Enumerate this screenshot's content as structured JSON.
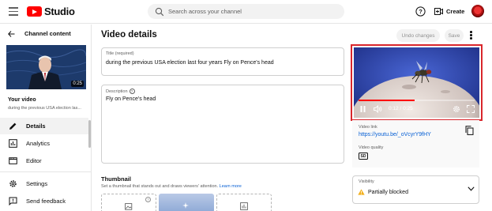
{
  "header": {
    "logo_text": "Studio",
    "search_placeholder": "Search across your channel",
    "create_label": "Create"
  },
  "sidebar": {
    "back_label": "Channel content",
    "thumbnail_duration": "0:25",
    "your_video_label": "Your video",
    "your_video_title": "during the previous USA election las...",
    "items": [
      {
        "label": "Details",
        "icon": "pencil-icon",
        "active": true
      },
      {
        "label": "Analytics",
        "icon": "analytics-icon",
        "active": false
      },
      {
        "label": "Editor",
        "icon": "editor-icon",
        "active": false
      },
      {
        "label": "Settings",
        "icon": "gear-icon",
        "active": false
      },
      {
        "label": "Send feedback",
        "icon": "feedback-icon",
        "active": false
      }
    ]
  },
  "main": {
    "page_title": "Video details",
    "undo_label": "Undo changes",
    "save_label": "Save",
    "title_field": {
      "label": "Title (required)",
      "value": "during the previous USA election last four years Fly on Pence's head"
    },
    "description_field": {
      "label": "Description",
      "value": "Fly on Pence's head"
    },
    "thumbnail": {
      "heading": "Thumbnail",
      "subtitle": "Set a thumbnail that stands out and draws viewers' attention.",
      "learn_more": "Learn more"
    }
  },
  "player": {
    "time": "0:12 / 0:25",
    "progress": 0.48
  },
  "video_info": {
    "link_label": "Video link",
    "link": "https://youtu.be/_oVcyrY9fHY",
    "quality_label": "Video quality",
    "quality_badge": "SD"
  },
  "visibility": {
    "label": "Visibility",
    "value": "Partially blocked"
  },
  "colors": {
    "brand_red": "#ff0000",
    "link_blue": "#065fd4",
    "highlight_border": "#d9262c",
    "warning": "#f2b01e"
  }
}
